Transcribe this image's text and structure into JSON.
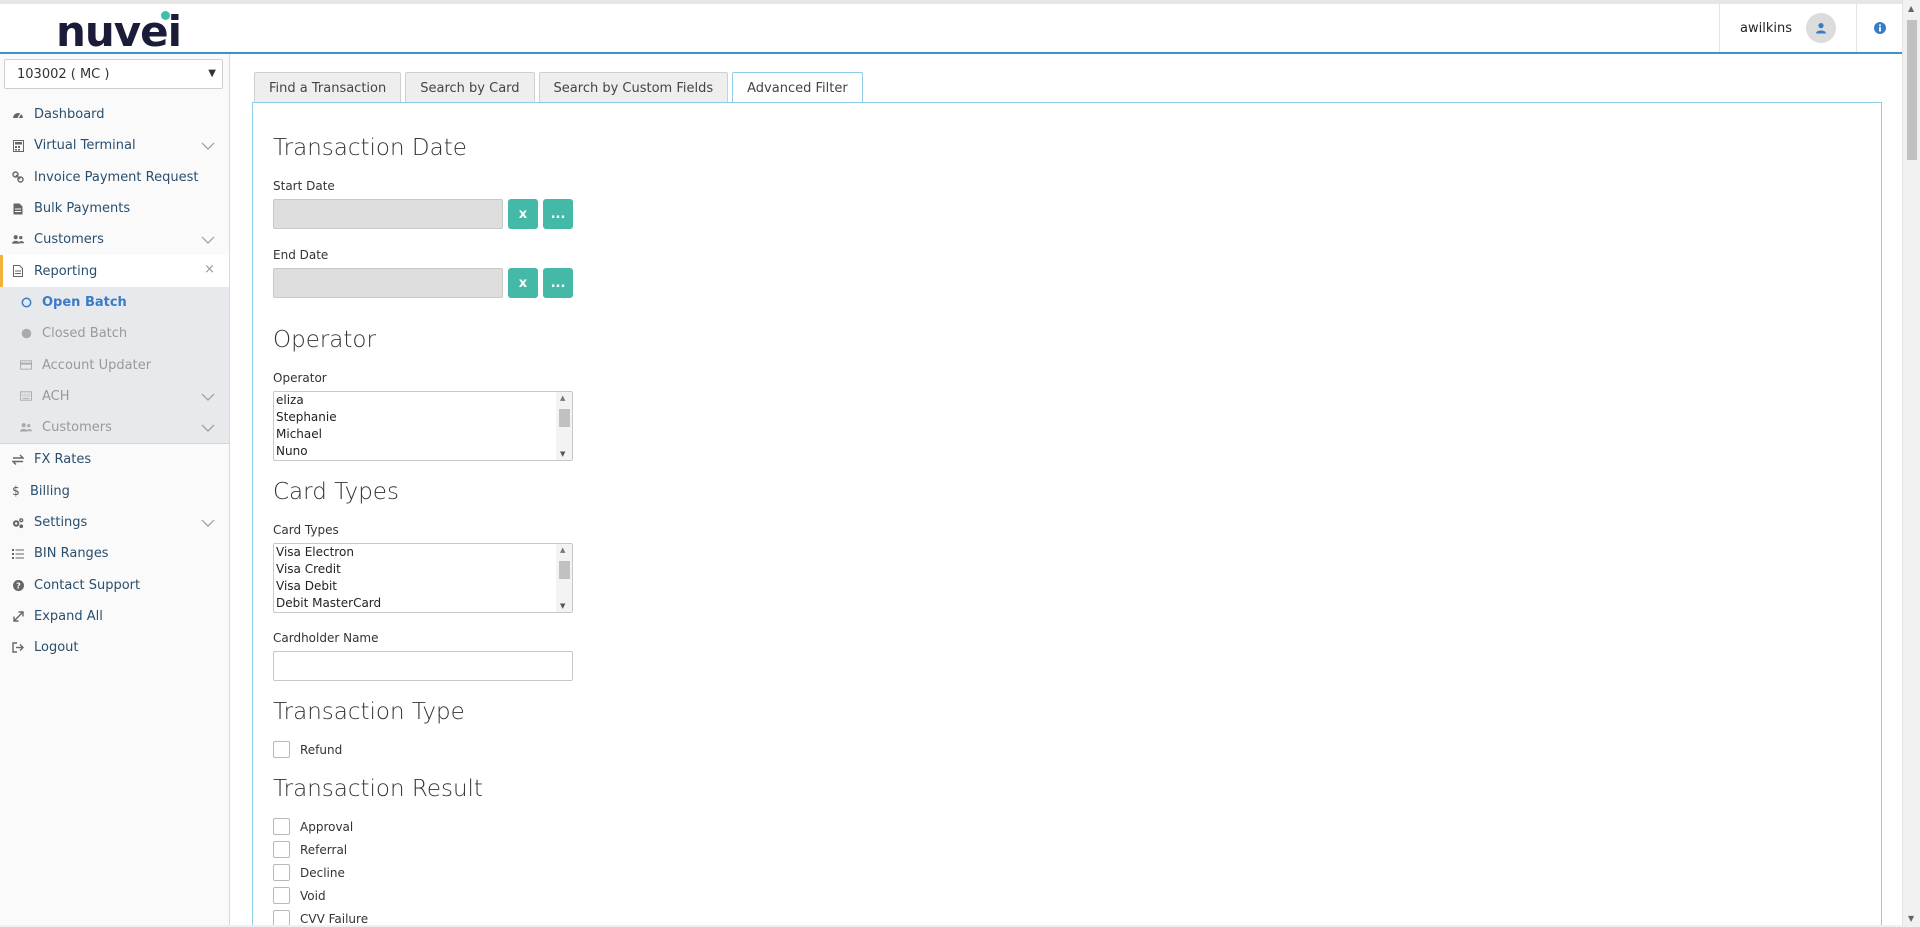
{
  "header": {
    "logo_text": "nuvei",
    "username": "awilkins",
    "user_icon": "user-icon",
    "info_icon": "info-icon",
    "colors": {
      "accent": "#3a93c9",
      "brand_dot": "#3fbfa9",
      "logo": "#1b1c3a"
    }
  },
  "sidebar": {
    "account": "103002 ( MC )",
    "items": [
      {
        "label": "Dashboard",
        "icon": "dashboard-icon"
      },
      {
        "label": "Virtual Terminal",
        "icon": "calculator-icon"
      },
      {
        "label": "Invoice Payment Request",
        "icon": "link-icon"
      },
      {
        "label": "Bulk Payments",
        "icon": "file-icon"
      },
      {
        "label": "Customers",
        "icon": "users-icon"
      },
      {
        "label": "Reporting",
        "icon": "report-icon"
      }
    ],
    "subitems": [
      {
        "label": "Open Batch",
        "icon": "circle-outline-icon"
      },
      {
        "label": "Closed Batch",
        "icon": "circle-filled-icon"
      },
      {
        "label": "Account Updater",
        "icon": "credit-card-icon"
      },
      {
        "label": "ACH",
        "icon": "keyboard-icon"
      },
      {
        "label": "Customers",
        "icon": "users-icon"
      }
    ],
    "items_after": [
      {
        "label": "FX Rates",
        "icon": "exchange-icon"
      },
      {
        "label": "Billing",
        "icon": "dollar-icon"
      },
      {
        "label": "Settings",
        "icon": "cogs-icon"
      },
      {
        "label": "BIN Ranges",
        "icon": "list-icon"
      },
      {
        "label": "Contact Support",
        "icon": "question-icon"
      },
      {
        "label": "Expand All",
        "icon": "expand-icon"
      },
      {
        "label": "Logout",
        "icon": "logout-icon"
      }
    ],
    "active_color": "#f2b23c"
  },
  "tabs": [
    "Find a Transaction",
    "Search by Card",
    "Search by Custom Fields",
    "Advanced Filter"
  ],
  "form": {
    "transaction_date_heading": "Transaction Date",
    "start_date_label": "Start Date",
    "end_date_label": "End Date",
    "clear_label": "x",
    "pick_label": "...",
    "operator_heading": "Operator",
    "operator_label": "Operator",
    "operators": [
      "eliza",
      "Stephanie",
      "Michael",
      "Nuno"
    ],
    "card_types_heading": "Card Types",
    "card_types_label": "Card Types",
    "card_types": [
      "Visa Electron",
      "Visa Credit",
      "Visa Debit",
      "Debit MasterCard"
    ],
    "cardholder_label": "Cardholder Name",
    "cardholder_value": "",
    "transaction_type_heading": "Transaction Type",
    "transaction_types": [
      "Refund"
    ],
    "transaction_result_heading": "Transaction Result",
    "transaction_results": [
      "Approval",
      "Referral",
      "Decline",
      "Void",
      "CVV Failure"
    ],
    "button_color": "#45b9a7"
  }
}
